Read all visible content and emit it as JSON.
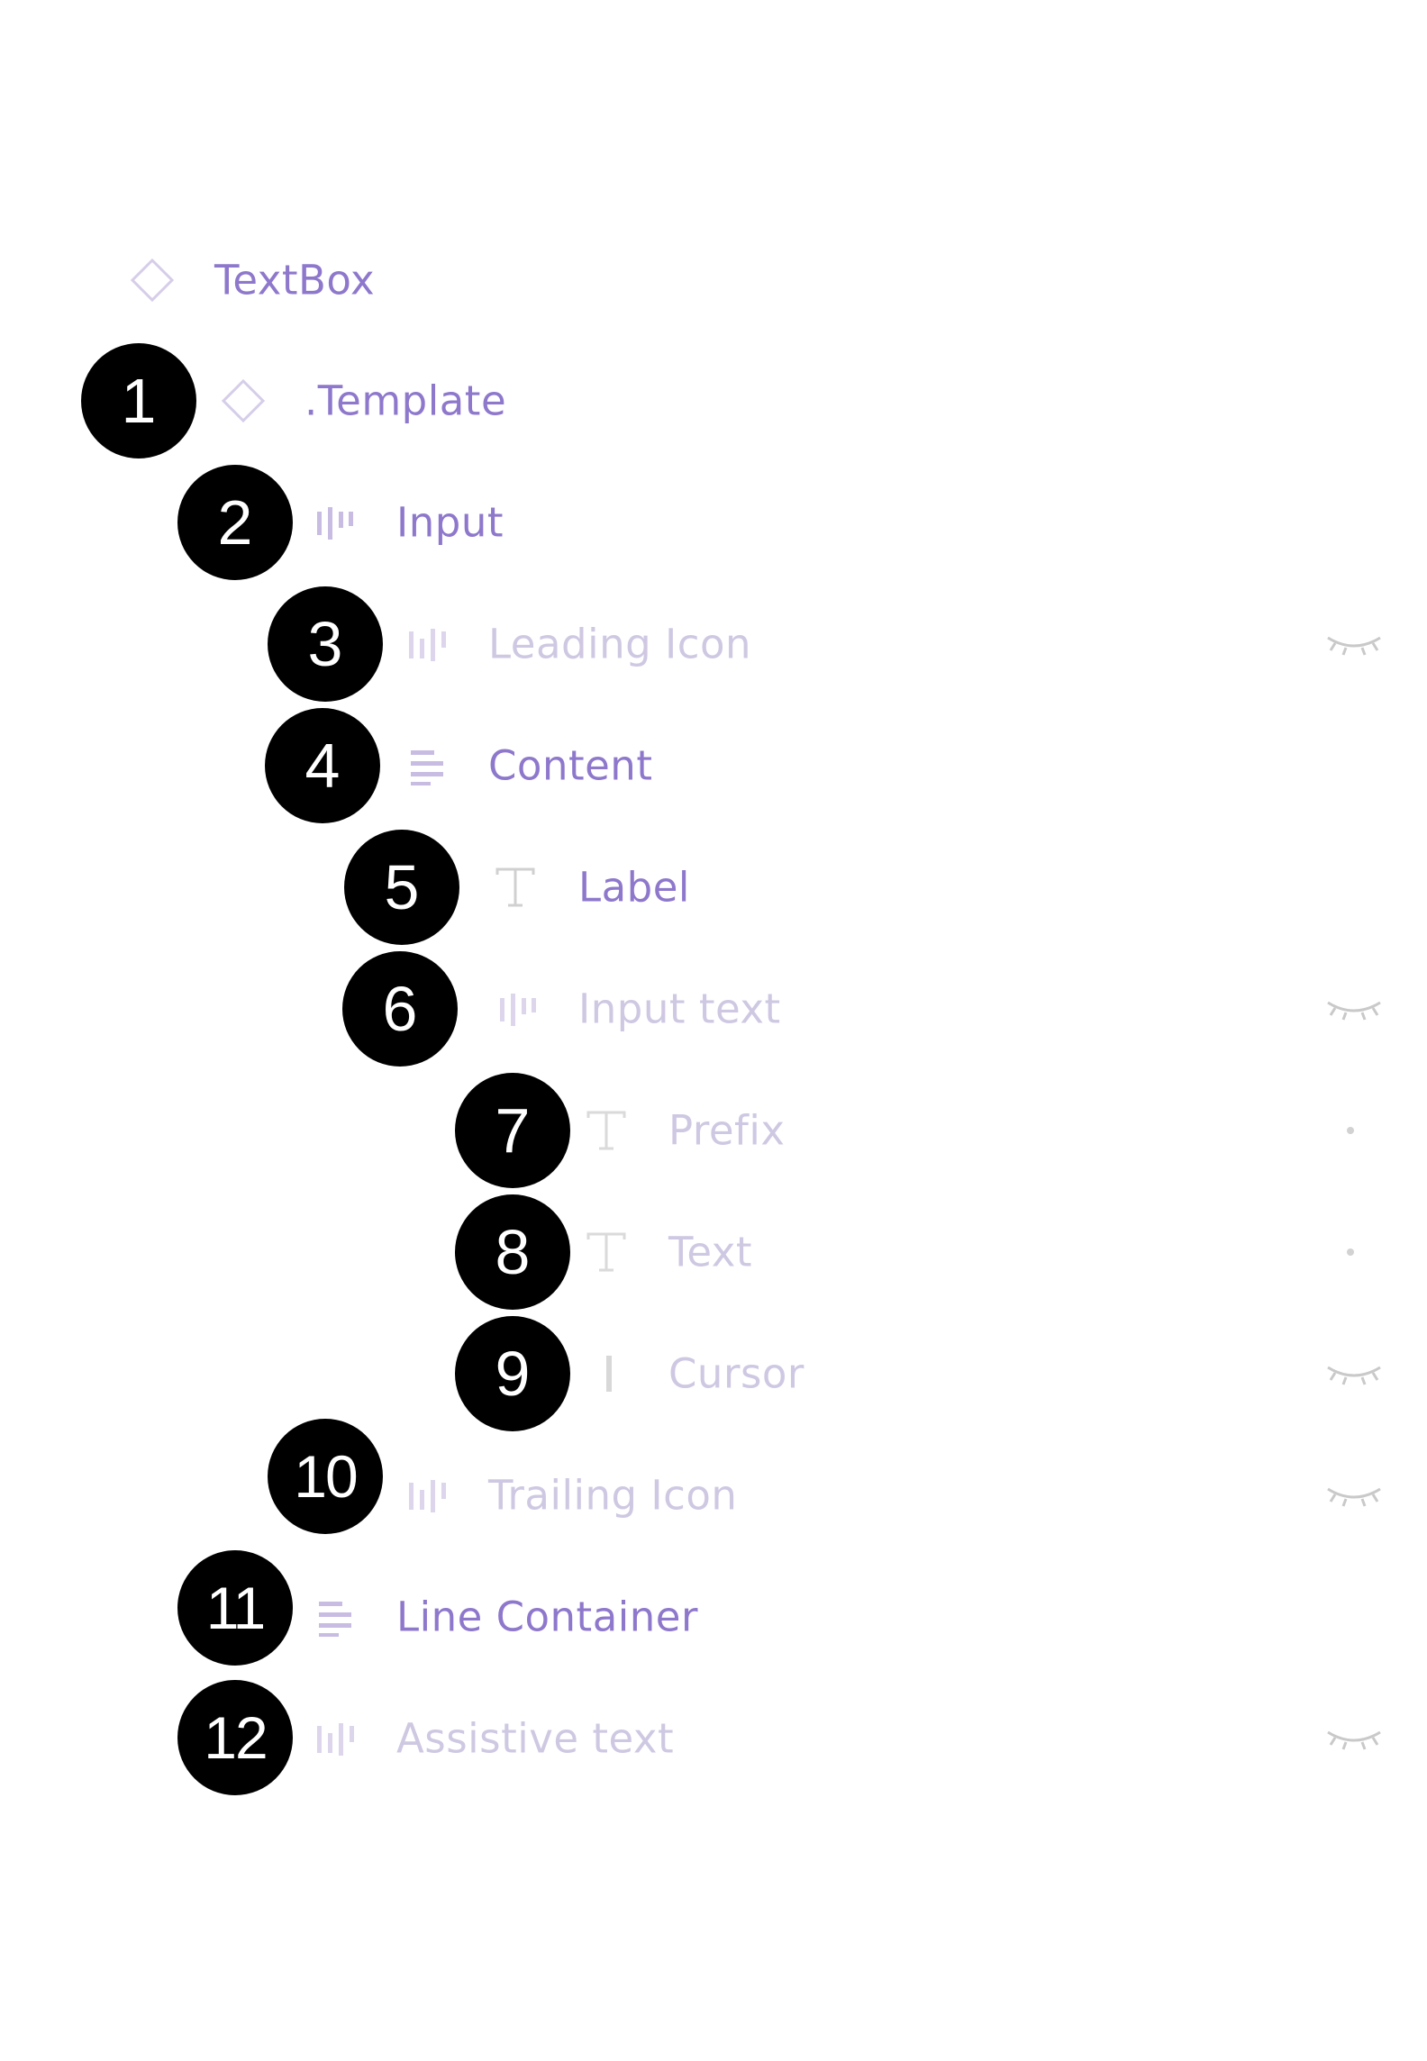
{
  "layers": [
    {
      "label": "TextBox",
      "icon": "component-diamond-icon",
      "state": "visible"
    },
    {
      "label": ".Template",
      "icon": "component-diamond-icon",
      "state": "visible",
      "badge": "1"
    },
    {
      "label": "Input",
      "icon": "horizontal-autolayout-icon",
      "state": "visible",
      "badge": "2"
    },
    {
      "label": "Leading Icon",
      "icon": "horizontal-autolayout-icon",
      "state": "hidden",
      "badge": "3",
      "trailing": "eye-closed-icon"
    },
    {
      "label": "Content",
      "icon": "vertical-autolayout-icon",
      "state": "visible",
      "badge": "4"
    },
    {
      "label": "Label",
      "icon": "text-layer-icon",
      "state": "visible",
      "badge": "5"
    },
    {
      "label": "Input text",
      "icon": "horizontal-autolayout-icon",
      "state": "hidden",
      "badge": "6",
      "trailing": "eye-closed-icon"
    },
    {
      "label": "Prefix",
      "icon": "text-layer-icon",
      "state": "hidden",
      "badge": "7",
      "trailing": "dot-icon"
    },
    {
      "label": "Text",
      "icon": "text-layer-icon",
      "state": "hidden",
      "badge": "8",
      "trailing": "dot-icon"
    },
    {
      "label": "Cursor",
      "icon": "rectangle-bar-icon",
      "state": "hidden",
      "badge": "9",
      "trailing": "eye-closed-icon"
    },
    {
      "label": "Trailing Icon",
      "icon": "horizontal-autolayout-icon",
      "state": "hidden",
      "badge": "10",
      "trailing": "eye-closed-icon"
    },
    {
      "label": "Line Container",
      "icon": "vertical-autolayout-icon",
      "state": "visible",
      "badge": "11"
    },
    {
      "label": "Assistive text",
      "icon": "horizontal-autolayout-icon",
      "state": "hidden",
      "badge": "12",
      "trailing": "eye-closed-icon"
    }
  ],
  "colors": {
    "label_visible": "#8e78cc",
    "label_hidden": "#cfc8e2",
    "icon": "#b9abdc",
    "icon_hidden": "#d9d2ea",
    "badge_bg": "#000000",
    "badge_text": "#ffffff"
  }
}
